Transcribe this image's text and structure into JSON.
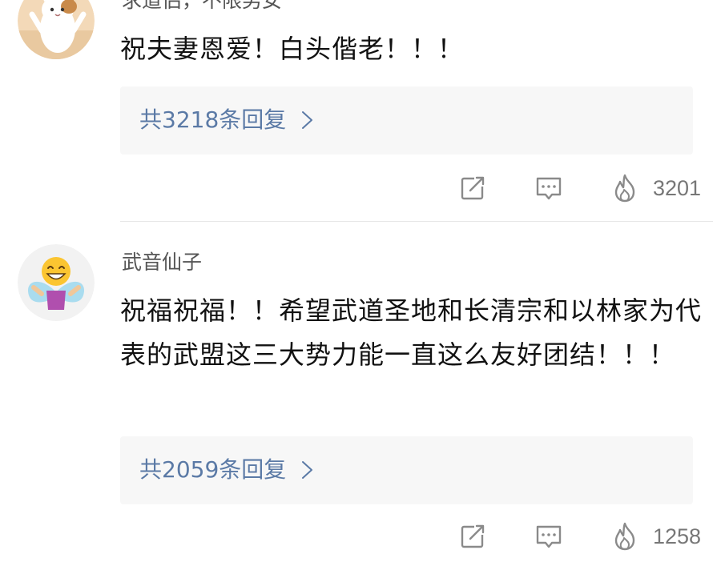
{
  "comments": [
    {
      "username": "求道侣，不限男女",
      "avatar_icon": "cat-avatar-icon",
      "text": "祝夫妻恩爱！白头偕老！！！",
      "replies_label": "共3218条回复",
      "like_count": "3201"
    },
    {
      "username": "武音仙子",
      "avatar_icon": "emoji-fairy-avatar-icon",
      "text": "祝福祝福！！希望武道圣地和长清宗和以林家为代表的武盟这三大势力能一直这么友好团结！！！",
      "replies_label": "共2059条回复",
      "like_count": "1258"
    }
  ],
  "icons": {
    "share": "share-icon",
    "comment": "comment-icon",
    "like": "flame-like-icon",
    "chevron": "chevron-right-icon"
  },
  "colors": {
    "reply_link": "#5b7aa6",
    "reply_box_bg": "#f7f7f7",
    "username": "#555555",
    "body_text": "#111111",
    "icon_gray": "#8a8a8a"
  }
}
